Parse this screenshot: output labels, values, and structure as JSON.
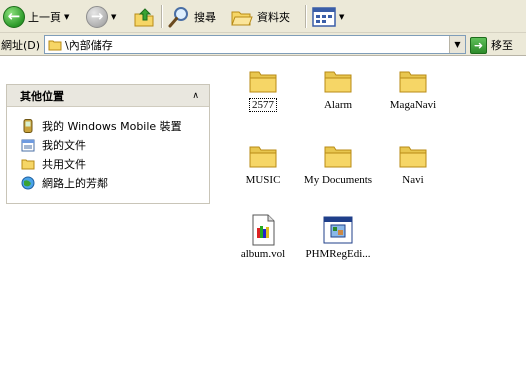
{
  "toolbar": {
    "back_label": "上一頁",
    "search_label": "搜尋",
    "folders_label": "資料夾"
  },
  "address": {
    "label": "網址(D)",
    "value": "\\內部儲存",
    "go_label": "移至"
  },
  "other_places": {
    "title": "其他位置",
    "items": [
      {
        "label": "我的 Windows Mobile 裝置",
        "icon": "mobile-device-icon"
      },
      {
        "label": "我的文件",
        "icon": "my-documents-icon"
      },
      {
        "label": "共用文件",
        "icon": "shared-folder-icon"
      },
      {
        "label": "網路上的芳鄰",
        "icon": "network-places-icon"
      }
    ]
  },
  "files": [
    {
      "name": "2577",
      "type": "folder"
    },
    {
      "name": "Alarm",
      "type": "folder"
    },
    {
      "name": "MagaNavi",
      "type": "folder"
    },
    {
      "name": "MUSIC",
      "type": "folder"
    },
    {
      "name": "My Documents",
      "type": "folder"
    },
    {
      "name": "Navi",
      "type": "folder"
    },
    {
      "name": "album.vol",
      "type": "file"
    },
    {
      "name": "PHMRegEdi...",
      "type": "application"
    }
  ],
  "colors": {
    "toolbar_bg": "#ece9d8",
    "folder_yellow": "#f6d666",
    "back_green": "#2d9a2a"
  }
}
